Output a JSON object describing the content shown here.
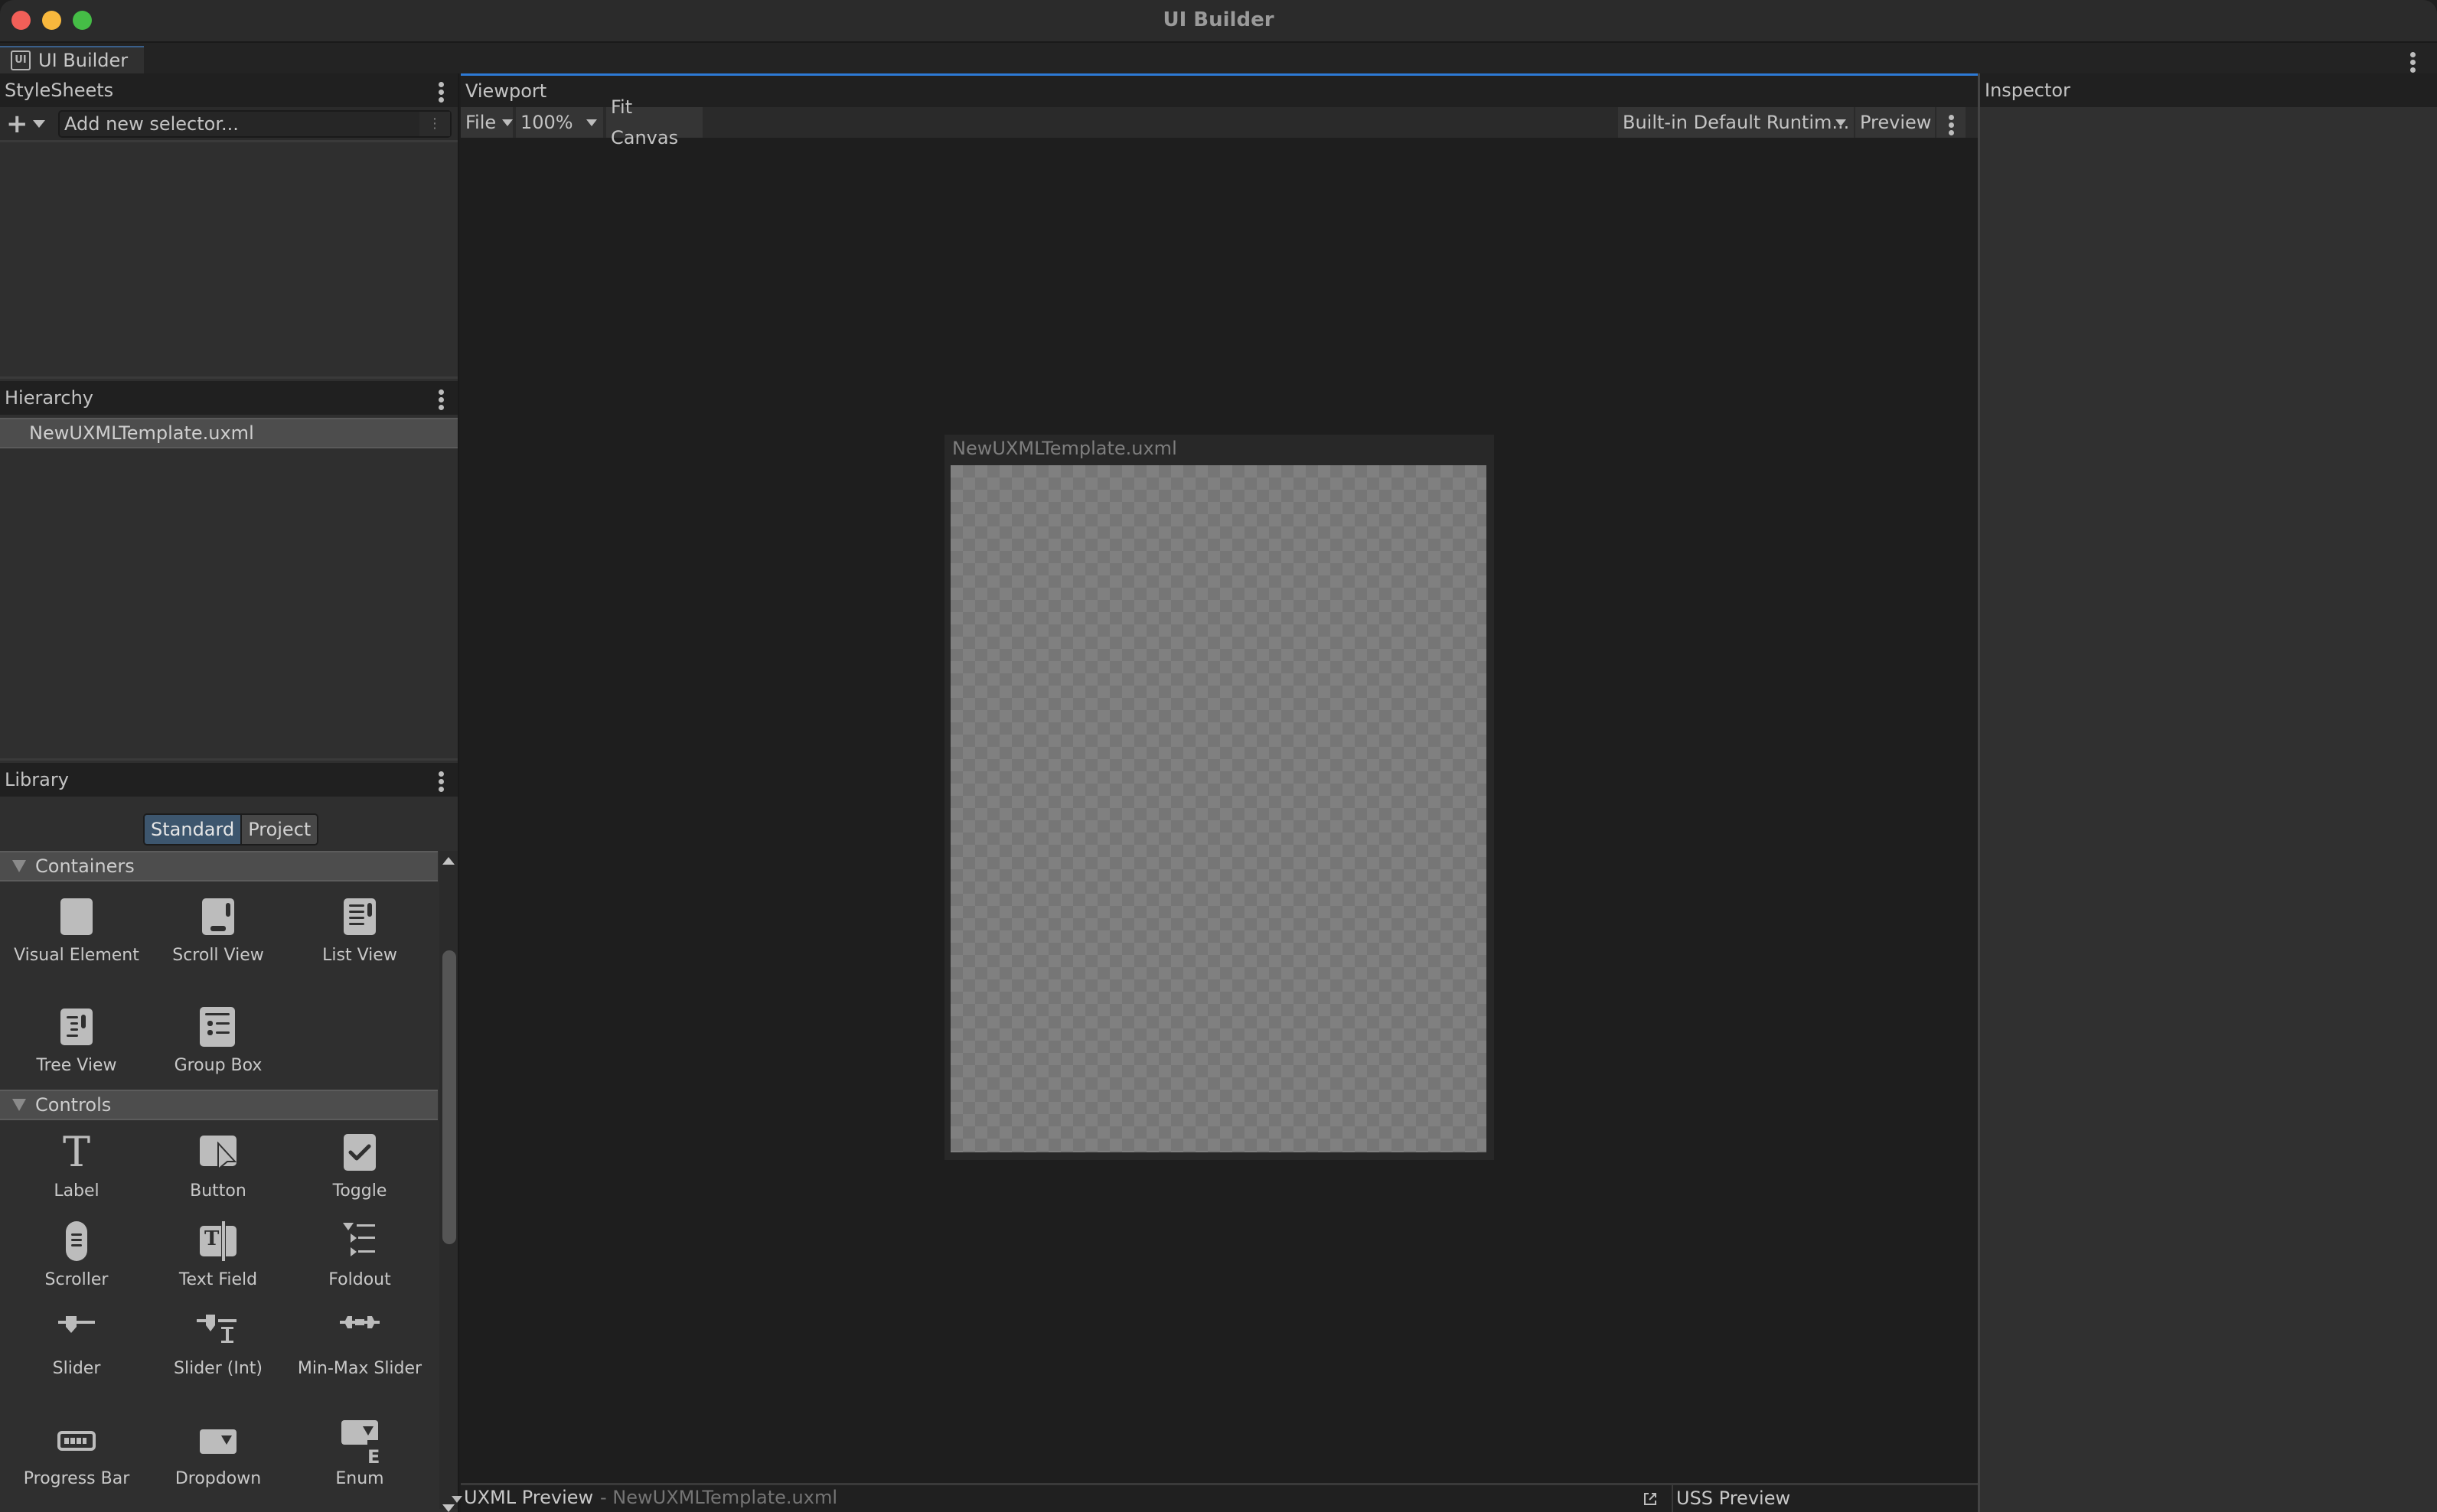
{
  "window": {
    "title": "UI Builder",
    "tab_label": "UI Builder",
    "tab_icon": "ui-builder-icon",
    "tab_icon_text": "UI"
  },
  "stylesheets": {
    "title": "StyleSheets",
    "add_selector_placeholder": "Add new selector...",
    "add_icon": "plus-icon"
  },
  "hierarchy": {
    "title": "Hierarchy",
    "items": [
      {
        "label": "NewUXMLTemplate.uxml",
        "selected": true
      }
    ]
  },
  "library": {
    "title": "Library",
    "tabs": [
      {
        "label": "Standard",
        "active": true
      },
      {
        "label": "Project",
        "active": false
      }
    ],
    "sections": [
      {
        "label": "Containers",
        "expanded": true,
        "items": [
          {
            "label": "Visual Element",
            "icon": "visual-element-icon"
          },
          {
            "label": "Scroll View",
            "icon": "scroll-view-icon"
          },
          {
            "label": "List View",
            "icon": "list-view-icon"
          },
          {
            "label": "Tree View",
            "icon": "tree-view-icon"
          },
          {
            "label": "Group Box",
            "icon": "group-box-icon"
          }
        ]
      },
      {
        "label": "Controls",
        "expanded": true,
        "items": [
          {
            "label": "Label",
            "icon": "label-icon"
          },
          {
            "label": "Button",
            "icon": "button-icon"
          },
          {
            "label": "Toggle",
            "icon": "toggle-icon"
          },
          {
            "label": "Scroller",
            "icon": "scroller-icon"
          },
          {
            "label": "Text Field",
            "icon": "text-field-icon"
          },
          {
            "label": "Foldout",
            "icon": "foldout-icon"
          },
          {
            "label": "Slider",
            "icon": "slider-icon"
          },
          {
            "label": "Slider (Int)",
            "icon": "slider-int-icon"
          },
          {
            "label": "Min-Max Slider",
            "icon": "min-max-slider-icon"
          },
          {
            "label": "Progress Bar",
            "icon": "progress-bar-icon"
          },
          {
            "label": "Dropdown",
            "icon": "dropdown-icon"
          },
          {
            "label": "Enum",
            "icon": "enum-icon"
          }
        ]
      }
    ]
  },
  "viewport": {
    "title": "Viewport",
    "toolbar": {
      "file_label": "File",
      "zoom_value": "100%",
      "fit_canvas_label": "Fit Canvas",
      "theme_value": "Built-in Default Runtim...",
      "preview_label": "Preview"
    },
    "canvas": {
      "title": "NewUXMLTemplate.uxml"
    },
    "uxml_preview": {
      "title": "UXML Preview",
      "file": "- NewUXMLTemplate.uxml"
    },
    "uss_preview": {
      "title": "USS Preview"
    }
  },
  "inspector": {
    "title": "Inspector"
  },
  "colors": {
    "accent_blue": "#2d7ad6",
    "active_tab": "#3d566e",
    "traffic_close": "#f25f58",
    "traffic_minimize": "#f8b83d",
    "traffic_maximize": "#45bd46"
  }
}
